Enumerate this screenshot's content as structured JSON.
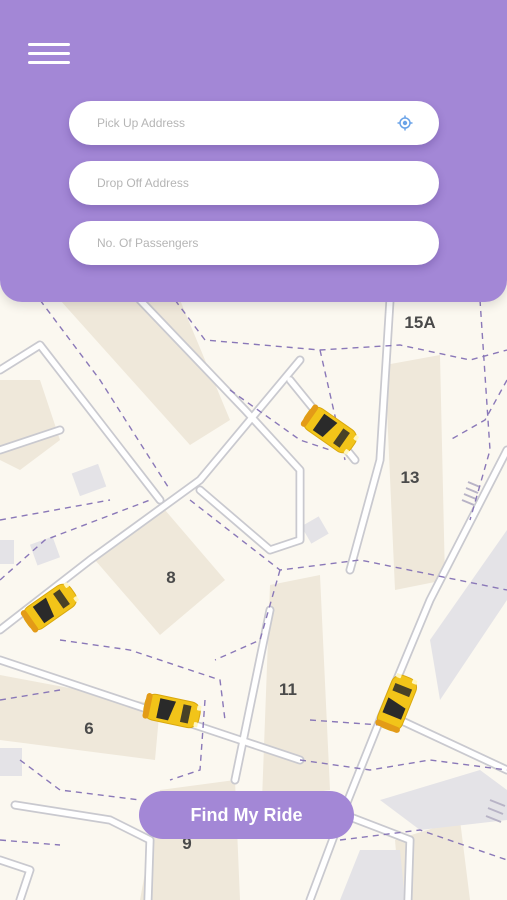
{
  "header": {
    "menu_icon": "hamburger-menu-icon",
    "pickup_placeholder": "Pick Up Address",
    "dropoff_placeholder": "Drop Off Address",
    "passengers_placeholder": "No. Of Passengers",
    "location_icon": "current-location-icon"
  },
  "map": {
    "block_labels": [
      "15A",
      "13",
      "8",
      "11",
      "6",
      "9"
    ],
    "car_icon": "taxi-car-icon"
  },
  "actions": {
    "find_ride_label": "Find My Ride"
  },
  "colors": {
    "accent": "#a387d6",
    "map_background": "#fbf8f0",
    "building": "#efe9dc",
    "road": "#c9c9cf",
    "boundary_dash": "#8a78b8",
    "car_yellow": "#f2c419"
  }
}
